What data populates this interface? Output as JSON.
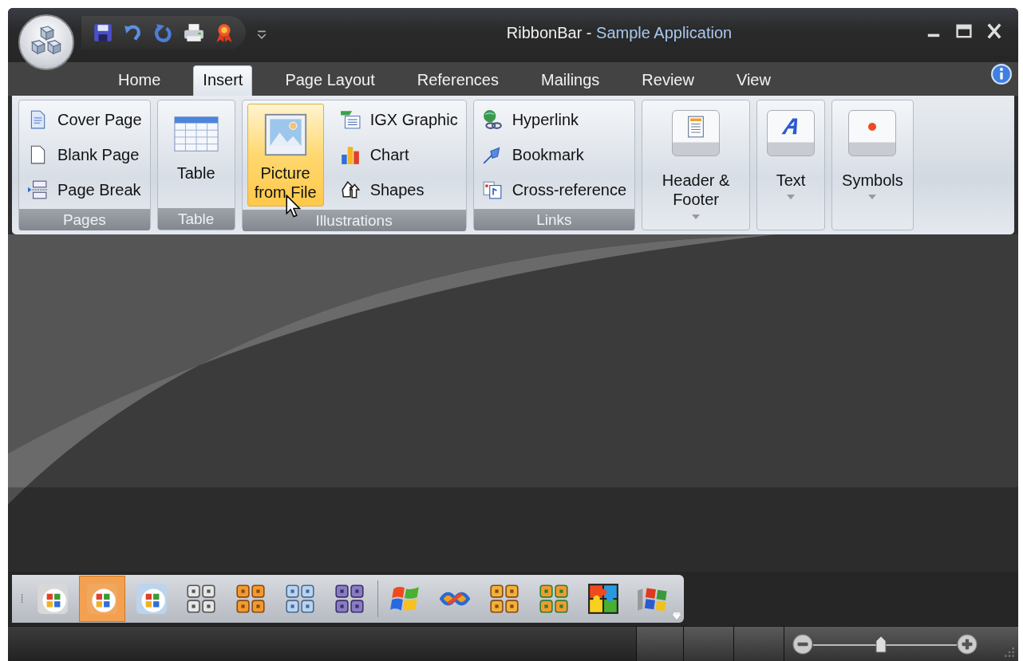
{
  "window": {
    "title": [
      {
        "text": "RibbonBar - ",
        "kind": "plain"
      },
      {
        "text": "Sample Application",
        "kind": "accent"
      }
    ]
  },
  "tabs": [
    {
      "label": "Home",
      "selected": false
    },
    {
      "label": "Insert",
      "selected": true
    },
    {
      "label": "Page Layout",
      "selected": false
    },
    {
      "label": "References",
      "selected": false
    },
    {
      "label": "Mailings",
      "selected": false
    },
    {
      "label": "Review",
      "selected": false
    },
    {
      "label": "View",
      "selected": false
    }
  ],
  "ribbon_groups": [
    {
      "caption": "Pages",
      "kind": "list",
      "items": [
        {
          "label": "Cover Page"
        },
        {
          "label": "Blank Page"
        },
        {
          "label": "Page Break"
        }
      ]
    },
    {
      "caption": "Table",
      "kind": "large",
      "items": [
        {
          "label": "Table",
          "hovered": false
        }
      ]
    },
    {
      "caption": "Illustrations",
      "kind": "mixed",
      "items": [
        {
          "label": "Picture from File",
          "hovered": true
        },
        {
          "label": "IGX Graphic"
        },
        {
          "label": "Chart"
        },
        {
          "label": "Shapes"
        }
      ]
    },
    {
      "caption": "Links",
      "kind": "list",
      "items": [
        {
          "label": "Hyperlink"
        },
        {
          "label": "Bookmark"
        },
        {
          "label": "Cross-reference"
        }
      ]
    },
    {
      "kind": "dropdown",
      "items": [
        {
          "label": "Header & Footer"
        }
      ]
    },
    {
      "kind": "dropdown",
      "items": [
        {
          "label": "Text"
        }
      ]
    },
    {
      "kind": "dropdown",
      "items": [
        {
          "label": "Symbols"
        }
      ]
    }
  ],
  "style_toolbar": [
    {
      "selected": false
    },
    {
      "selected": true
    },
    {
      "selected": false
    },
    {
      "selected": false
    },
    {
      "selected": false
    },
    {
      "selected": false
    },
    {
      "selected": false
    },
    {
      "selected": false
    },
    {
      "selected": false
    },
    {
      "selected": false
    },
    {
      "selected": false
    },
    {
      "selected": false
    },
    {
      "selected": false
    }
  ],
  "status_bar": {
    "zoom": {
      "level": 0.47
    }
  }
}
